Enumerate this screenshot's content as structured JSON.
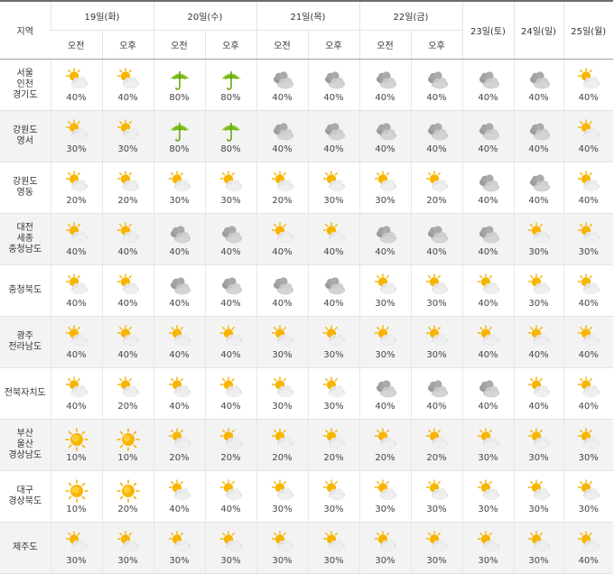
{
  "header": {
    "region_label": "지역",
    "am_label": "오전",
    "pm_label": "오후",
    "days_ampm": [
      "19일(화)",
      "20일(수)",
      "21일(목)",
      "22일(금)"
    ],
    "days_single": [
      "23일(토)",
      "24일(일)",
      "25일(월)"
    ]
  },
  "icons": {
    "sun": "sun-icon",
    "partly": "partly-cloudy-icon",
    "cloudy": "cloudy-icon",
    "rain": "umbrella-rain-icon"
  },
  "rows": [
    {
      "name": "서울\n인천\n경기도",
      "cells": [
        {
          "icon": "partly",
          "pct": "40%"
        },
        {
          "icon": "partly",
          "pct": "40%"
        },
        {
          "icon": "rain",
          "pct": "80%"
        },
        {
          "icon": "rain",
          "pct": "80%"
        },
        {
          "icon": "cloudy",
          "pct": "40%"
        },
        {
          "icon": "cloudy",
          "pct": "40%"
        },
        {
          "icon": "cloudy",
          "pct": "40%"
        },
        {
          "icon": "cloudy",
          "pct": "40%"
        },
        {
          "icon": "cloudy",
          "pct": "40%"
        },
        {
          "icon": "cloudy",
          "pct": "40%"
        },
        {
          "icon": "partly",
          "pct": "40%"
        }
      ]
    },
    {
      "name": "강원도\n영서",
      "cells": [
        {
          "icon": "partly",
          "pct": "30%"
        },
        {
          "icon": "partly",
          "pct": "30%"
        },
        {
          "icon": "rain",
          "pct": "80%"
        },
        {
          "icon": "rain",
          "pct": "80%"
        },
        {
          "icon": "cloudy",
          "pct": "40%"
        },
        {
          "icon": "cloudy",
          "pct": "40%"
        },
        {
          "icon": "cloudy",
          "pct": "40%"
        },
        {
          "icon": "cloudy",
          "pct": "40%"
        },
        {
          "icon": "cloudy",
          "pct": "40%"
        },
        {
          "icon": "cloudy",
          "pct": "40%"
        },
        {
          "icon": "partly",
          "pct": "40%"
        }
      ]
    },
    {
      "name": "강원도\n영동",
      "cells": [
        {
          "icon": "partly",
          "pct": "20%"
        },
        {
          "icon": "partly",
          "pct": "20%"
        },
        {
          "icon": "partly",
          "pct": "30%"
        },
        {
          "icon": "partly",
          "pct": "30%"
        },
        {
          "icon": "partly",
          "pct": "20%"
        },
        {
          "icon": "partly",
          "pct": "30%"
        },
        {
          "icon": "partly",
          "pct": "30%"
        },
        {
          "icon": "partly",
          "pct": "20%"
        },
        {
          "icon": "cloudy",
          "pct": "40%"
        },
        {
          "icon": "cloudy",
          "pct": "40%"
        },
        {
          "icon": "partly",
          "pct": "40%"
        }
      ]
    },
    {
      "name": "대전\n세종\n충청남도",
      "cells": [
        {
          "icon": "partly",
          "pct": "40%"
        },
        {
          "icon": "partly",
          "pct": "40%"
        },
        {
          "icon": "cloudy",
          "pct": "40%"
        },
        {
          "icon": "cloudy",
          "pct": "40%"
        },
        {
          "icon": "partly",
          "pct": "40%"
        },
        {
          "icon": "partly",
          "pct": "40%"
        },
        {
          "icon": "cloudy",
          "pct": "40%"
        },
        {
          "icon": "cloudy",
          "pct": "40%"
        },
        {
          "icon": "cloudy",
          "pct": "40%"
        },
        {
          "icon": "partly",
          "pct": "30%"
        },
        {
          "icon": "partly",
          "pct": "30%"
        }
      ]
    },
    {
      "name": "충청북도",
      "cells": [
        {
          "icon": "partly",
          "pct": "40%"
        },
        {
          "icon": "partly",
          "pct": "40%"
        },
        {
          "icon": "cloudy",
          "pct": "40%"
        },
        {
          "icon": "cloudy",
          "pct": "40%"
        },
        {
          "icon": "cloudy",
          "pct": "40%"
        },
        {
          "icon": "cloudy",
          "pct": "40%"
        },
        {
          "icon": "partly",
          "pct": "30%"
        },
        {
          "icon": "partly",
          "pct": "30%"
        },
        {
          "icon": "partly",
          "pct": "40%"
        },
        {
          "icon": "partly",
          "pct": "30%"
        },
        {
          "icon": "partly",
          "pct": "40%"
        }
      ]
    },
    {
      "name": "광주\n전라남도",
      "cells": [
        {
          "icon": "partly",
          "pct": "40%"
        },
        {
          "icon": "partly",
          "pct": "40%"
        },
        {
          "icon": "partly",
          "pct": "40%"
        },
        {
          "icon": "partly",
          "pct": "40%"
        },
        {
          "icon": "partly",
          "pct": "30%"
        },
        {
          "icon": "partly",
          "pct": "30%"
        },
        {
          "icon": "partly",
          "pct": "30%"
        },
        {
          "icon": "partly",
          "pct": "30%"
        },
        {
          "icon": "partly",
          "pct": "40%"
        },
        {
          "icon": "partly",
          "pct": "40%"
        },
        {
          "icon": "partly",
          "pct": "40%"
        }
      ]
    },
    {
      "name": "전북자치도",
      "cells": [
        {
          "icon": "partly",
          "pct": "40%"
        },
        {
          "icon": "partly",
          "pct": "20%"
        },
        {
          "icon": "partly",
          "pct": "40%"
        },
        {
          "icon": "partly",
          "pct": "40%"
        },
        {
          "icon": "partly",
          "pct": "30%"
        },
        {
          "icon": "partly",
          "pct": "30%"
        },
        {
          "icon": "cloudy",
          "pct": "40%"
        },
        {
          "icon": "cloudy",
          "pct": "40%"
        },
        {
          "icon": "cloudy",
          "pct": "40%"
        },
        {
          "icon": "partly",
          "pct": "40%"
        },
        {
          "icon": "partly",
          "pct": "40%"
        }
      ]
    },
    {
      "name": "부산\n울산\n경상남도",
      "cells": [
        {
          "icon": "sun",
          "pct": "10%"
        },
        {
          "icon": "sun",
          "pct": "10%"
        },
        {
          "icon": "partly",
          "pct": "20%"
        },
        {
          "icon": "partly",
          "pct": "20%"
        },
        {
          "icon": "partly",
          "pct": "20%"
        },
        {
          "icon": "partly",
          "pct": "20%"
        },
        {
          "icon": "partly",
          "pct": "20%"
        },
        {
          "icon": "partly",
          "pct": "20%"
        },
        {
          "icon": "partly",
          "pct": "30%"
        },
        {
          "icon": "partly",
          "pct": "30%"
        },
        {
          "icon": "partly",
          "pct": "30%"
        }
      ]
    },
    {
      "name": "대구\n경상북도",
      "cells": [
        {
          "icon": "sun",
          "pct": "10%"
        },
        {
          "icon": "sun",
          "pct": "20%"
        },
        {
          "icon": "partly",
          "pct": "40%"
        },
        {
          "icon": "partly",
          "pct": "40%"
        },
        {
          "icon": "partly",
          "pct": "30%"
        },
        {
          "icon": "partly",
          "pct": "30%"
        },
        {
          "icon": "partly",
          "pct": "30%"
        },
        {
          "icon": "partly",
          "pct": "30%"
        },
        {
          "icon": "partly",
          "pct": "30%"
        },
        {
          "icon": "partly",
          "pct": "30%"
        },
        {
          "icon": "partly",
          "pct": "30%"
        }
      ]
    },
    {
      "name": "제주도",
      "cells": [
        {
          "icon": "partly",
          "pct": "30%"
        },
        {
          "icon": "partly",
          "pct": "30%"
        },
        {
          "icon": "partly",
          "pct": "30%"
        },
        {
          "icon": "partly",
          "pct": "30%"
        },
        {
          "icon": "partly",
          "pct": "30%"
        },
        {
          "icon": "partly",
          "pct": "30%"
        },
        {
          "icon": "partly",
          "pct": "30%"
        },
        {
          "icon": "partly",
          "pct": "30%"
        },
        {
          "icon": "partly",
          "pct": "30%"
        },
        {
          "icon": "partly",
          "pct": "30%"
        },
        {
          "icon": "partly",
          "pct": "40%"
        }
      ]
    }
  ]
}
